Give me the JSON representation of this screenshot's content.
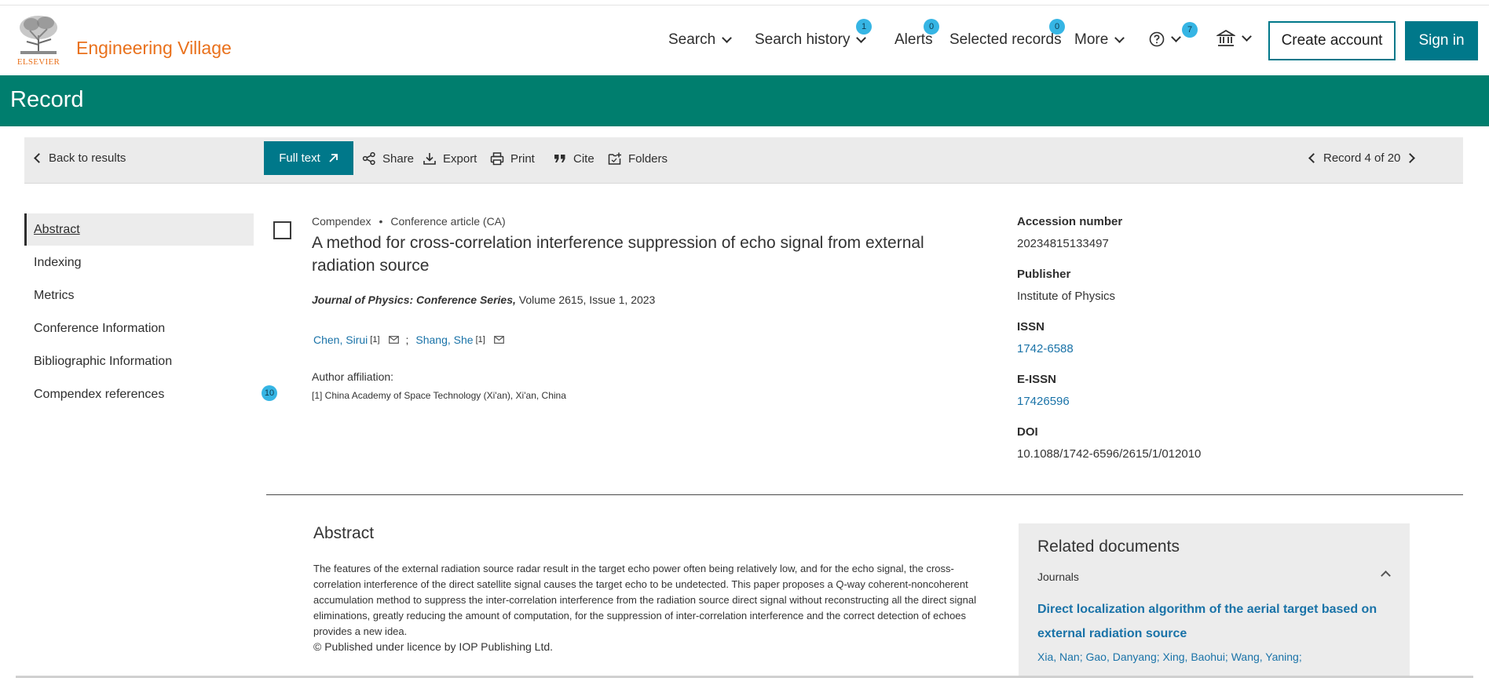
{
  "header": {
    "brand": "Engineering Village",
    "logo_text": "ELSEVIER",
    "nav": {
      "search": "Search",
      "search_history": "Search history",
      "search_history_count": "1",
      "alerts": "Alerts",
      "alerts_count": "0",
      "selected_records": "Selected records",
      "selected_records_count": "0",
      "more": "More",
      "help_count": "7"
    },
    "create_account": "Create account",
    "sign_in": "Sign in"
  },
  "page_title": "Record",
  "toolbar": {
    "back": "Back to results",
    "full_text": "Full text",
    "share": "Share",
    "export": "Export",
    "print": "Print",
    "cite": "Cite",
    "folders": "Folders",
    "record_position": "Record 4 of 20"
  },
  "sidebar": {
    "items": [
      {
        "label": "Abstract"
      },
      {
        "label": "Indexing"
      },
      {
        "label": "Metrics"
      },
      {
        "label": "Conference Information"
      },
      {
        "label": "Bibliographic Information"
      },
      {
        "label": "Compendex references"
      }
    ],
    "references_count": "10"
  },
  "record": {
    "database": "Compendex",
    "doc_type": "Conference article (CA)",
    "title": "A method for cross-correlation interference suppression of echo signal from external radiation source",
    "journal_name": "Journal of Physics: Conference Series,",
    "journal_details": "Volume 2615, Issue 1, 2023",
    "authors": [
      {
        "name": "Chen, Sirui",
        "ref": "[1]"
      },
      {
        "name": "Shang, She",
        "ref": "[1]"
      }
    ],
    "author_separator": ";",
    "affiliation_label": "Author affiliation:",
    "affiliation": "[1] China Academy of Space Technology (Xi'an), Xi'an, China"
  },
  "meta": {
    "accession_label": "Accession number",
    "accession": "20234815133497",
    "publisher_label": "Publisher",
    "publisher": "Institute of Physics",
    "issn_label": "ISSN",
    "issn": "1742-6588",
    "eissn_label": "E-ISSN",
    "eissn": "17426596",
    "doi_label": "DOI",
    "doi": "10.1088/1742-6596/2615/1/012010"
  },
  "abstract": {
    "heading": "Abstract",
    "text": "The features of the external radiation source radar result in the target echo power often being relatively low, and for the echo signal, the cross-correlation interference of the direct satellite signal causes the target echo to be undetected. This paper proposes a Q-way coherent-noncoherent accumulation method to suppress the inter-correlation interference from the radiation source direct signal without reconstructing all the direct signal eliminations, greatly reducing the amount of computation, for the suppression of inter-correlation interference and the correct detection of echoes provides a new idea.",
    "copyright": "© Published under licence by IOP Publishing Ltd."
  },
  "related": {
    "heading": "Related documents",
    "section": "Journals",
    "link": "Direct localization algorithm of the aerial target based on external radiation source",
    "authors": "Xia, Nan; Gao, Danyang; Xing, Baohui; Wang, Yaning;"
  },
  "colors": {
    "teal": "#007e6e",
    "button": "#00788a",
    "orange": "#e9711c",
    "badge": "#36b5e4",
    "link": "#1a73a8"
  }
}
